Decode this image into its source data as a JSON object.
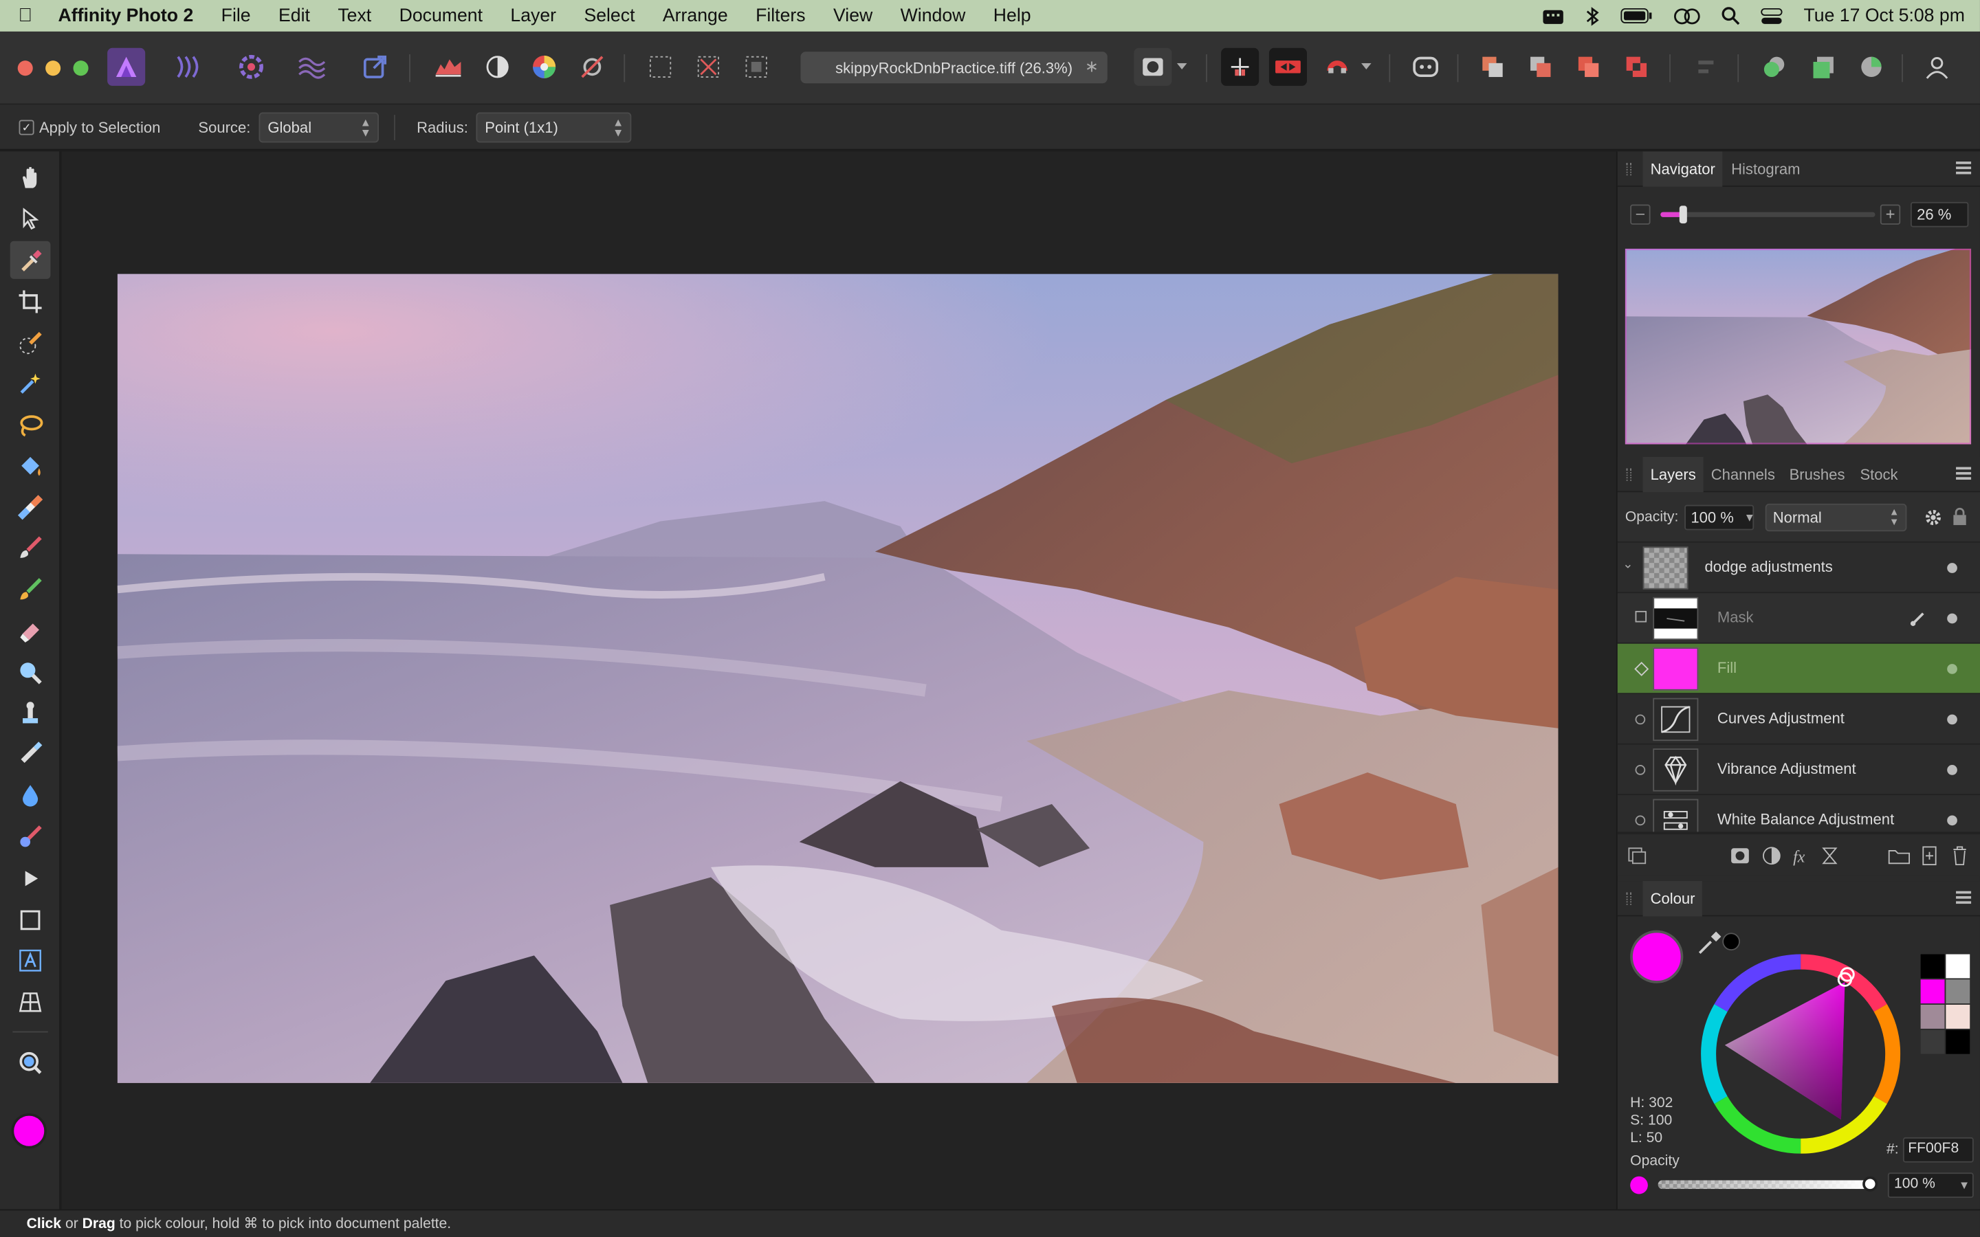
{
  "menubar": {
    "app_name": "Affinity Photo 2",
    "items": [
      "File",
      "Edit",
      "Text",
      "Document",
      "Layer",
      "Select",
      "Arrange",
      "Filters",
      "View",
      "Window",
      "Help"
    ],
    "clock": "Tue 17 Oct  5:08 pm"
  },
  "toolbar": {
    "document_tab": "skippyRockDnbPractice.tiff (26.3%)",
    "close_glyph": "∗"
  },
  "context_bar": {
    "apply_label": "Apply to Selection",
    "source_label": "Source:",
    "source_value": "Global",
    "radius_label": "Radius:",
    "radius_value": "Point (1x1)"
  },
  "navigator": {
    "tabs": [
      "Navigator",
      "Histogram"
    ],
    "zoom": "26 %"
  },
  "layers": {
    "tabs": [
      "Layers",
      "Channels",
      "Brushes",
      "Stock"
    ],
    "opacity_label": "Opacity:",
    "opacity_value": "100 %",
    "blend_mode": "Normal",
    "items": [
      {
        "name": "dodge adjustments"
      },
      {
        "name": "Mask"
      },
      {
        "name": "Fill"
      },
      {
        "name": "Curves Adjustment"
      },
      {
        "name": "Vibrance Adjustment"
      },
      {
        "name": "White Balance Adjustment"
      }
    ]
  },
  "colour": {
    "tab": "Colour",
    "h": "H: 302",
    "s": "S: 100",
    "l": "L: 50",
    "hex_label": "#:",
    "hex": "FF00F8",
    "opacity_label": "Opacity",
    "opacity_value": "100 %",
    "current_color": "#ff00f8"
  },
  "status": {
    "click": "Click",
    "or": " or ",
    "drag": "Drag",
    "rest": " to pick colour, hold ⌘ to pick into document palette."
  }
}
